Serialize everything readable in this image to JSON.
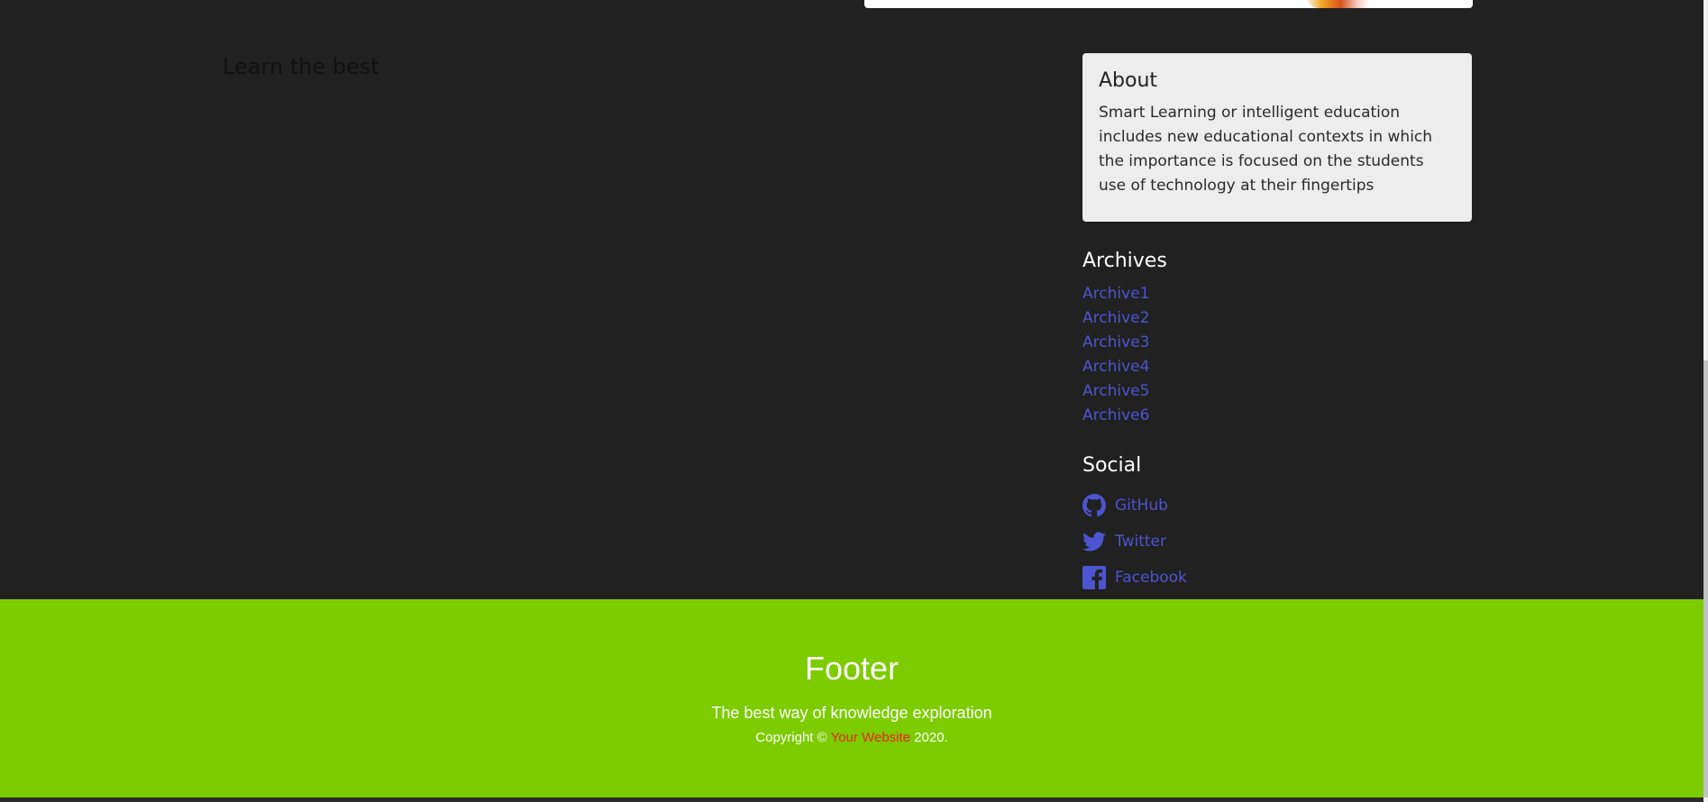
{
  "main": {
    "heading": "Learn the best"
  },
  "sidebar": {
    "about": {
      "title": "About",
      "text": "Smart Learning or intelligent education includes new educational contexts in which the importance is focused on the students use of technology at their fingertips"
    },
    "archives": {
      "title": "Archives",
      "items": [
        {
          "label": "Archive1"
        },
        {
          "label": "Archive2"
        },
        {
          "label": "Archive3"
        },
        {
          "label": "Archive4"
        },
        {
          "label": "Archive5"
        },
        {
          "label": "Archive6"
        }
      ]
    },
    "social": {
      "title": "Social",
      "items": [
        {
          "label": "GitHub",
          "icon": "github-icon"
        },
        {
          "label": "Twitter",
          "icon": "twitter-icon"
        },
        {
          "label": "Facebook",
          "icon": "facebook-icon"
        }
      ]
    }
  },
  "footer": {
    "title": "Footer",
    "tagline": "The best way of knowledge exploration",
    "copyright_prefix": "Copyright ©",
    "site_link": "Your Website",
    "copyright_suffix": "2020."
  },
  "colors": {
    "page_background": "#212121",
    "footer_background": "#7ccc00",
    "link": "#4b55d0",
    "footer_link": "#e8230d",
    "about_background": "#ededed"
  }
}
